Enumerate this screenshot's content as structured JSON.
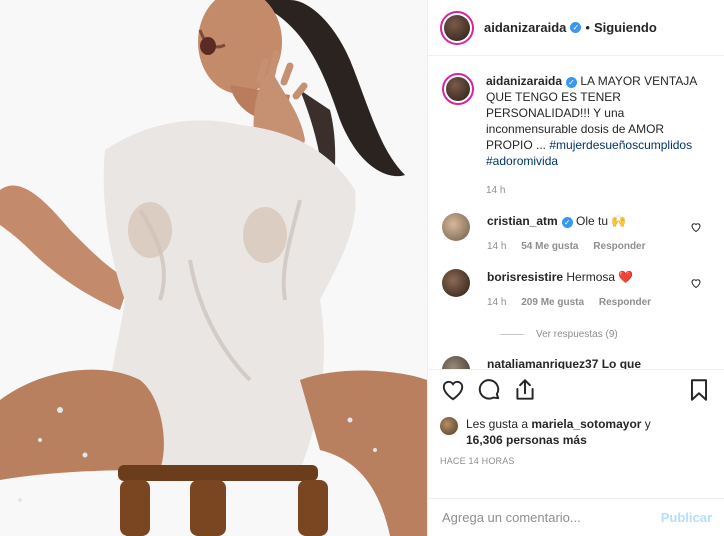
{
  "post": {
    "author": "aidanizaraida",
    "follow_separator": "•",
    "follow_label": "Siguiendo"
  },
  "caption": {
    "user": "aidanizaraida",
    "text": "LA MAYOR VENTAJA QUE TENGO ES TENER PERSONALIDAD!!! Y una inconmensurable dosis de AMOR PROPIO ...",
    "hashtag1": "#mujerdesueñoscumplidos",
    "hashtag2": "#adoromivida",
    "time": "14 h"
  },
  "comments": [
    {
      "user": "cristian_atm",
      "text": "Ole tu 🙌",
      "time": "14 h",
      "likes": "54 Me gusta",
      "reply": "Responder",
      "verified": true
    },
    {
      "user": "borisresistire",
      "text": "Hermosa ❤️",
      "time": "14 h",
      "likes": "209 Me gusta",
      "reply": "Responder",
      "verified": false
    }
  ],
  "replies_label": "Ver respuestas (9)",
  "partial_comment": "nataliamanriquez37 Lo que",
  "likes": {
    "prefix": "Les gusta a ",
    "user": "mariela_sotomayor",
    "connector": " y",
    "count": "16,306 personas más"
  },
  "timestamp": "HACE 14 HORAS",
  "add_comment": {
    "placeholder": "Agrega un comentario...",
    "post_label": "Publicar"
  },
  "icons": {
    "verified": "verified-badge-icon",
    "like": "heart-icon",
    "comment": "comment-icon",
    "share": "share-icon",
    "save": "bookmark-icon"
  },
  "colors": {
    "accent": "#3897f0",
    "link": "#003569",
    "muted": "#8e8e8e",
    "publish_disabled": "#b2dffc",
    "heart_red": "#ed4956"
  }
}
